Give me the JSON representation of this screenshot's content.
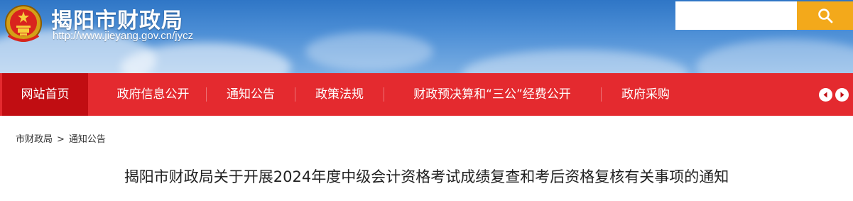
{
  "header": {
    "title": "揭阳市财政局",
    "url": "http://www.jieyang.gov.cn/jycz",
    "emblem_icon": "national-emblem-icon"
  },
  "search": {
    "value": "",
    "button_icon": "search-icon",
    "button_color": "#f3a91b"
  },
  "nav": {
    "items": [
      {
        "label": "网站首页",
        "active": true
      },
      {
        "label": "政府信息公开"
      },
      {
        "label": "通知公告"
      },
      {
        "label": "政策法规"
      },
      {
        "label": "财政预决算和“三公”经费公开"
      },
      {
        "label": "政府采购"
      }
    ],
    "prev_icon": "chevron-left-icon",
    "next_icon": "chevron-right-icon",
    "bg_color": "#e42a2f",
    "active_color": "#c10d12"
  },
  "breadcrumb": {
    "items": [
      "市财政局",
      "通知公告"
    ],
    "separator": ">"
  },
  "article": {
    "title": "揭阳市财政局关于开展2024年度中级会计资格考试成绩复查和考后资格复核有关事项的通知"
  }
}
